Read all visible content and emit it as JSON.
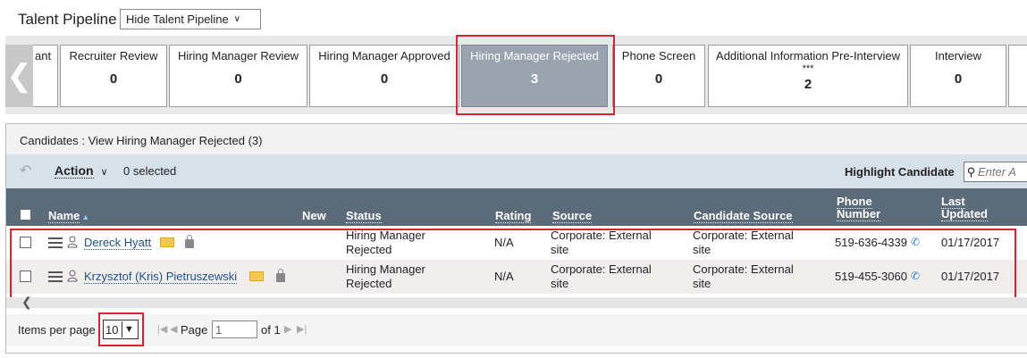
{
  "header": {
    "title": "Talent Pipeline",
    "hide_button": "Hide Talent Pipeline"
  },
  "pipeline": {
    "partial_stage_label": "ant",
    "stages": [
      {
        "label": "Recruiter Review",
        "count": "0"
      },
      {
        "label": "Hiring Manager Review",
        "count": "0"
      },
      {
        "label": "Hiring Manager Approved",
        "count": "0"
      },
      {
        "label": "Hiring Manager Rejected",
        "count": "3",
        "selected": true
      },
      {
        "label": "Phone Screen",
        "count": "0"
      },
      {
        "label": "Additional Information Pre-Interview",
        "stars": "***",
        "count": "2"
      },
      {
        "label": "Interview",
        "count": "0"
      }
    ]
  },
  "candidates": {
    "title": "Candidates : View Hiring Manager Rejected (3)",
    "toolbar": {
      "action": "Action",
      "selected": "0 selected",
      "highlight_label": "Highlight Candidate",
      "highlight_placeholder": "Enter A"
    },
    "columns": {
      "name": "Name",
      "new": "New",
      "status": "Status",
      "rating": "Rating",
      "source": "Source",
      "candidate_source": "Candidate Source",
      "phone": "Phone Number",
      "updated": "Last Updated"
    },
    "rows": [
      {
        "name": "Dereck Hyatt",
        "status": "Hiring Manager Rejected",
        "rating": "N/A",
        "source": "Corporate: External site",
        "candidate_source": "Corporate: External site",
        "phone": "519-636-4339",
        "updated": "01/17/2017"
      },
      {
        "name": "Krzysztof (Kris) Pietruszewski",
        "status": "Hiring Manager Rejected",
        "rating": "N/A",
        "source": "Corporate: External site",
        "candidate_source": "Corporate: External site",
        "phone": "519-455-3060",
        "updated": "01/17/2017"
      }
    ]
  },
  "pager": {
    "items_per_page_label": "Items per page",
    "items_per_page": "10",
    "page_label": "Page",
    "page_value": "1",
    "of_label": "of 1"
  },
  "colors": {
    "header_bar": "#5b6b7a",
    "selected_stage": "#9aa4ae",
    "highlight_red": "#d9232d",
    "link": "#1c4f8a"
  }
}
